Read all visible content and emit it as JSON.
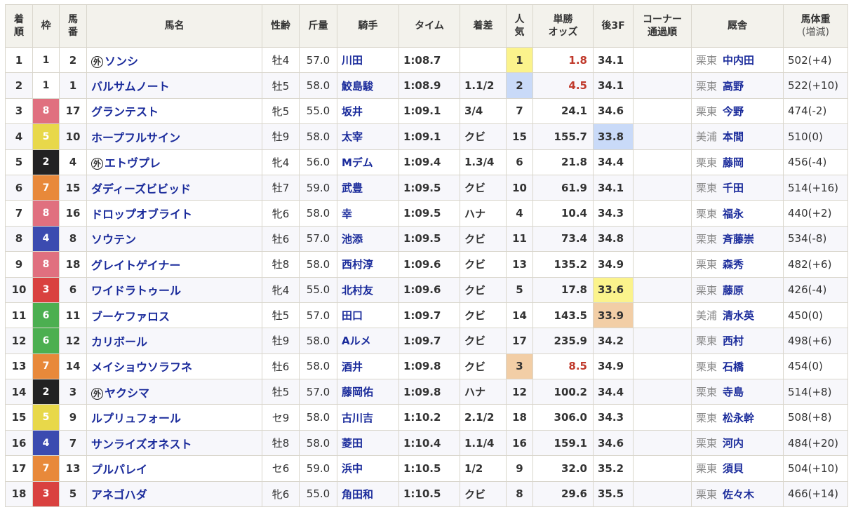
{
  "headers": {
    "rank": [
      "着",
      "順"
    ],
    "gate": "枠",
    "num": [
      "馬",
      "番"
    ],
    "horse": "馬名",
    "sexage": "性齢",
    "weight": "斤量",
    "jockey": "騎手",
    "time": "タイム",
    "margin": "着差",
    "pop": [
      "人",
      "気"
    ],
    "odds": [
      "単勝",
      "オッズ"
    ],
    "last3f": "後3F",
    "corner": [
      "コーナー",
      "通過順"
    ],
    "stable": "厩舎",
    "body": [
      "馬体重",
      "(増減)"
    ]
  },
  "gaikoku_mark": "外",
  "gate_colors": {
    "1": {
      "bg": "#ffffff",
      "fg": "#333333"
    },
    "2": {
      "bg": "#222222",
      "fg": "#ffffff"
    },
    "3": {
      "bg": "#d9413f",
      "fg": "#ffffff"
    },
    "4": {
      "bg": "#3b4bb0",
      "fg": "#ffffff"
    },
    "5": {
      "bg": "#e8d84a",
      "fg": "#ffffff"
    },
    "6": {
      "bg": "#4caf50",
      "fg": "#ffffff"
    },
    "7": {
      "bg": "#e8893a",
      "fg": "#ffffff"
    },
    "8": {
      "bg": "#e0707f",
      "fg": "#ffffff"
    }
  },
  "rows": [
    {
      "rank": "1",
      "gate": "1",
      "num": "2",
      "gaikoku": true,
      "horse": "ソンシ",
      "sexage": "牡4",
      "weight": "57.0",
      "jockey": "川田",
      "time": "1:08.7",
      "margin": "",
      "pop": "1",
      "pop_hl": "yellow",
      "odds": "1.8",
      "odds_red": true,
      "last3f": "34.1",
      "l3f_hl": "",
      "corner": "",
      "region": "栗東",
      "trainer": "中内田",
      "body": "502(+4)"
    },
    {
      "rank": "2",
      "gate": "1",
      "num": "1",
      "gaikoku": false,
      "horse": "バルサムノート",
      "sexage": "牡5",
      "weight": "58.0",
      "jockey": "鮫島駿",
      "time": "1:08.9",
      "margin": "1.1/2",
      "pop": "2",
      "pop_hl": "blue",
      "odds": "4.5",
      "odds_red": true,
      "last3f": "34.1",
      "l3f_hl": "",
      "corner": "",
      "region": "栗東",
      "trainer": "高野",
      "body": "522(+10)"
    },
    {
      "rank": "3",
      "gate": "8",
      "num": "17",
      "gaikoku": false,
      "horse": "グランテスト",
      "sexage": "牝5",
      "weight": "55.0",
      "jockey": "坂井",
      "time": "1:09.1",
      "margin": "3/4",
      "pop": "7",
      "pop_hl": "",
      "odds": "24.1",
      "odds_red": false,
      "last3f": "34.6",
      "l3f_hl": "",
      "corner": "",
      "region": "栗東",
      "trainer": "今野",
      "body": "474(-2)"
    },
    {
      "rank": "4",
      "gate": "5",
      "num": "10",
      "gaikoku": false,
      "horse": "ホープフルサイン",
      "sexage": "牡9",
      "weight": "58.0",
      "jockey": "太宰",
      "time": "1:09.1",
      "margin": "クビ",
      "pop": "15",
      "pop_hl": "",
      "odds": "155.7",
      "odds_red": false,
      "last3f": "33.8",
      "l3f_hl": "blue",
      "corner": "",
      "region": "美浦",
      "trainer": "本間",
      "body": "510(0)"
    },
    {
      "rank": "5",
      "gate": "2",
      "num": "4",
      "gaikoku": true,
      "horse": "エトヴプレ",
      "sexage": "牝4",
      "weight": "56.0",
      "jockey": "Mデム",
      "time": "1:09.4",
      "margin": "1.3/4",
      "pop": "6",
      "pop_hl": "",
      "odds": "21.8",
      "odds_red": false,
      "last3f": "34.4",
      "l3f_hl": "",
      "corner": "",
      "region": "栗東",
      "trainer": "藤岡",
      "body": "456(-4)"
    },
    {
      "rank": "6",
      "gate": "7",
      "num": "15",
      "gaikoku": false,
      "horse": "ダディーズビビッド",
      "sexage": "牡7",
      "weight": "59.0",
      "jockey": "武豊",
      "time": "1:09.5",
      "margin": "クビ",
      "pop": "10",
      "pop_hl": "",
      "odds": "61.9",
      "odds_red": false,
      "last3f": "34.1",
      "l3f_hl": "",
      "corner": "",
      "region": "栗東",
      "trainer": "千田",
      "body": "514(+16)"
    },
    {
      "rank": "7",
      "gate": "8",
      "num": "16",
      "gaikoku": false,
      "horse": "ドロップオブライト",
      "sexage": "牝6",
      "weight": "58.0",
      "jockey": "幸",
      "time": "1:09.5",
      "margin": "ハナ",
      "pop": "4",
      "pop_hl": "",
      "odds": "10.4",
      "odds_red": false,
      "last3f": "34.3",
      "l3f_hl": "",
      "corner": "",
      "region": "栗東",
      "trainer": "福永",
      "body": "440(+2)"
    },
    {
      "rank": "8",
      "gate": "4",
      "num": "8",
      "gaikoku": false,
      "horse": "ソウテン",
      "sexage": "牡6",
      "weight": "57.0",
      "jockey": "池添",
      "time": "1:09.5",
      "margin": "クビ",
      "pop": "11",
      "pop_hl": "",
      "odds": "73.4",
      "odds_red": false,
      "last3f": "34.8",
      "l3f_hl": "",
      "corner": "",
      "region": "栗東",
      "trainer": "斉藤崇",
      "body": "534(-8)"
    },
    {
      "rank": "9",
      "gate": "8",
      "num": "18",
      "gaikoku": false,
      "horse": "グレイトゲイナー",
      "sexage": "牡8",
      "weight": "58.0",
      "jockey": "西村淳",
      "time": "1:09.6",
      "margin": "クビ",
      "pop": "13",
      "pop_hl": "",
      "odds": "135.2",
      "odds_red": false,
      "last3f": "34.9",
      "l3f_hl": "",
      "corner": "",
      "region": "栗東",
      "trainer": "森秀",
      "body": "482(+6)"
    },
    {
      "rank": "10",
      "gate": "3",
      "num": "6",
      "gaikoku": false,
      "horse": "ワイドラトゥール",
      "sexage": "牝4",
      "weight": "55.0",
      "jockey": "北村友",
      "time": "1:09.6",
      "margin": "クビ",
      "pop": "5",
      "pop_hl": "",
      "odds": "17.8",
      "odds_red": false,
      "last3f": "33.6",
      "l3f_hl": "yellow",
      "corner": "",
      "region": "栗東",
      "trainer": "藤原",
      "body": "426(-4)"
    },
    {
      "rank": "11",
      "gate": "6",
      "num": "11",
      "gaikoku": false,
      "horse": "ブーケファロス",
      "sexage": "牡5",
      "weight": "57.0",
      "jockey": "田口",
      "time": "1:09.7",
      "margin": "クビ",
      "pop": "14",
      "pop_hl": "",
      "odds": "143.5",
      "odds_red": false,
      "last3f": "33.9",
      "l3f_hl": "orange",
      "corner": "",
      "region": "美浦",
      "trainer": "清水英",
      "body": "450(0)"
    },
    {
      "rank": "12",
      "gate": "6",
      "num": "12",
      "gaikoku": false,
      "horse": "カリボール",
      "sexage": "牡9",
      "weight": "58.0",
      "jockey": "Aルメ",
      "time": "1:09.7",
      "margin": "クビ",
      "pop": "17",
      "pop_hl": "",
      "odds": "235.9",
      "odds_red": false,
      "last3f": "34.2",
      "l3f_hl": "",
      "corner": "",
      "region": "栗東",
      "trainer": "西村",
      "body": "498(+6)"
    },
    {
      "rank": "13",
      "gate": "7",
      "num": "14",
      "gaikoku": false,
      "horse": "メイショウソラフネ",
      "sexage": "牡6",
      "weight": "58.0",
      "jockey": "酒井",
      "time": "1:09.8",
      "margin": "クビ",
      "pop": "3",
      "pop_hl": "orange",
      "odds": "8.5",
      "odds_red": true,
      "last3f": "34.9",
      "l3f_hl": "",
      "corner": "",
      "region": "栗東",
      "trainer": "石橋",
      "body": "454(0)"
    },
    {
      "rank": "14",
      "gate": "2",
      "num": "3",
      "gaikoku": true,
      "horse": "ヤクシマ",
      "sexage": "牡5",
      "weight": "57.0",
      "jockey": "藤岡佑",
      "time": "1:09.8",
      "margin": "ハナ",
      "pop": "12",
      "pop_hl": "",
      "odds": "100.2",
      "odds_red": false,
      "last3f": "34.4",
      "l3f_hl": "",
      "corner": "",
      "region": "栗東",
      "trainer": "寺島",
      "body": "514(+8)"
    },
    {
      "rank": "15",
      "gate": "5",
      "num": "9",
      "gaikoku": false,
      "horse": "ルプリュフォール",
      "sexage": "セ9",
      "weight": "58.0",
      "jockey": "古川吉",
      "time": "1:10.2",
      "margin": "2.1/2",
      "pop": "18",
      "pop_hl": "",
      "odds": "306.0",
      "odds_red": false,
      "last3f": "34.3",
      "l3f_hl": "",
      "corner": "",
      "region": "栗東",
      "trainer": "松永幹",
      "body": "508(+8)"
    },
    {
      "rank": "16",
      "gate": "4",
      "num": "7",
      "gaikoku": false,
      "horse": "サンライズオネスト",
      "sexage": "牡8",
      "weight": "58.0",
      "jockey": "菱田",
      "time": "1:10.4",
      "margin": "1.1/4",
      "pop": "16",
      "pop_hl": "",
      "odds": "159.1",
      "odds_red": false,
      "last3f": "34.6",
      "l3f_hl": "",
      "corner": "",
      "region": "栗東",
      "trainer": "河内",
      "body": "484(+20)"
    },
    {
      "rank": "17",
      "gate": "7",
      "num": "13",
      "gaikoku": false,
      "horse": "プルパレイ",
      "sexage": "セ6",
      "weight": "59.0",
      "jockey": "浜中",
      "time": "1:10.5",
      "margin": "1/2",
      "pop": "9",
      "pop_hl": "",
      "odds": "32.0",
      "odds_red": false,
      "last3f": "35.2",
      "l3f_hl": "",
      "corner": "",
      "region": "栗東",
      "trainer": "須貝",
      "body": "504(+10)"
    },
    {
      "rank": "18",
      "gate": "3",
      "num": "5",
      "gaikoku": false,
      "horse": "アネゴハダ",
      "sexage": "牝6",
      "weight": "55.0",
      "jockey": "角田和",
      "time": "1:10.5",
      "margin": "クビ",
      "pop": "8",
      "pop_hl": "",
      "odds": "29.6",
      "odds_red": false,
      "last3f": "35.5",
      "l3f_hl": "",
      "corner": "",
      "region": "栗東",
      "trainer": "佐々木",
      "body": "466(+14)"
    }
  ]
}
